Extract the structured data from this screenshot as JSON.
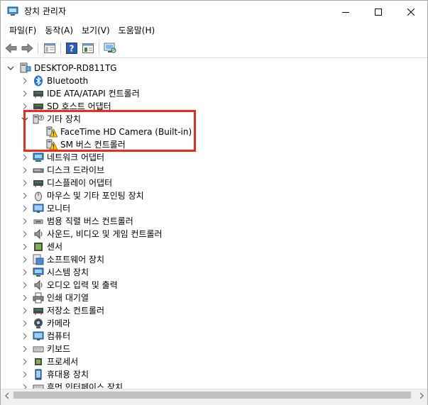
{
  "window": {
    "title": "장치 관리자"
  },
  "menu": [
    "파일(F)",
    "동작(A)",
    "보기(V)",
    "도움말(H)"
  ],
  "tree": {
    "root": "DESKTOP-RD811TG",
    "items": [
      {
        "label": "Bluetooth",
        "icon": "bluetooth-icon"
      },
      {
        "label": "IDE ATA/ATAPI 컨트롤러",
        "icon": "ide-controller-icon"
      },
      {
        "label": "SD 호스트 어댑터",
        "icon": "sd-host-icon"
      },
      {
        "label": "기타 장치",
        "icon": "other-devices-icon",
        "expanded": true,
        "children": [
          {
            "label": "FaceTime HD Camera (Built-in)",
            "icon": "warning-device-icon"
          },
          {
            "label": "SM 버스 컨트롤러",
            "icon": "warning-device-icon"
          }
        ]
      },
      {
        "label": "네트워크 어댑터",
        "icon": "network-adapter-icon"
      },
      {
        "label": "디스크 드라이브",
        "icon": "disk-drive-icon"
      },
      {
        "label": "디스플레이 어댑터",
        "icon": "display-adapter-icon"
      },
      {
        "label": "마우스 및 기타 포인팅 장치",
        "icon": "mouse-icon"
      },
      {
        "label": "모니터",
        "icon": "monitor-icon"
      },
      {
        "label": "범용 직렬 버스 컨트롤러",
        "icon": "usb-controller-icon"
      },
      {
        "label": "사운드, 비디오 및 게임 컨트롤러",
        "icon": "speaker-icon"
      },
      {
        "label": "센서",
        "icon": "sensor-icon"
      },
      {
        "label": "소프트웨어 장치",
        "icon": "software-device-icon"
      },
      {
        "label": "시스템 장치",
        "icon": "system-device-icon"
      },
      {
        "label": "오디오 입력 및 출력",
        "icon": "audio-icon"
      },
      {
        "label": "인쇄 대기열",
        "icon": "printer-icon"
      },
      {
        "label": "저장소 컨트롤러",
        "icon": "storage-controller-icon"
      },
      {
        "label": "카메라",
        "icon": "camera-icon"
      },
      {
        "label": "컴퓨터",
        "icon": "computer-icon"
      },
      {
        "label": "키보드",
        "icon": "keyboard-icon"
      },
      {
        "label": "프로세서",
        "icon": "processor-icon"
      },
      {
        "label": "휴대용 장치",
        "icon": "portable-device-icon"
      },
      {
        "label": "휴먼 인터페이스 장치",
        "icon": "hid-icon"
      }
    ]
  },
  "colors": {
    "highlight": "#f02a1a",
    "warning": "#f5c400",
    "accent": "#1e70d8"
  }
}
